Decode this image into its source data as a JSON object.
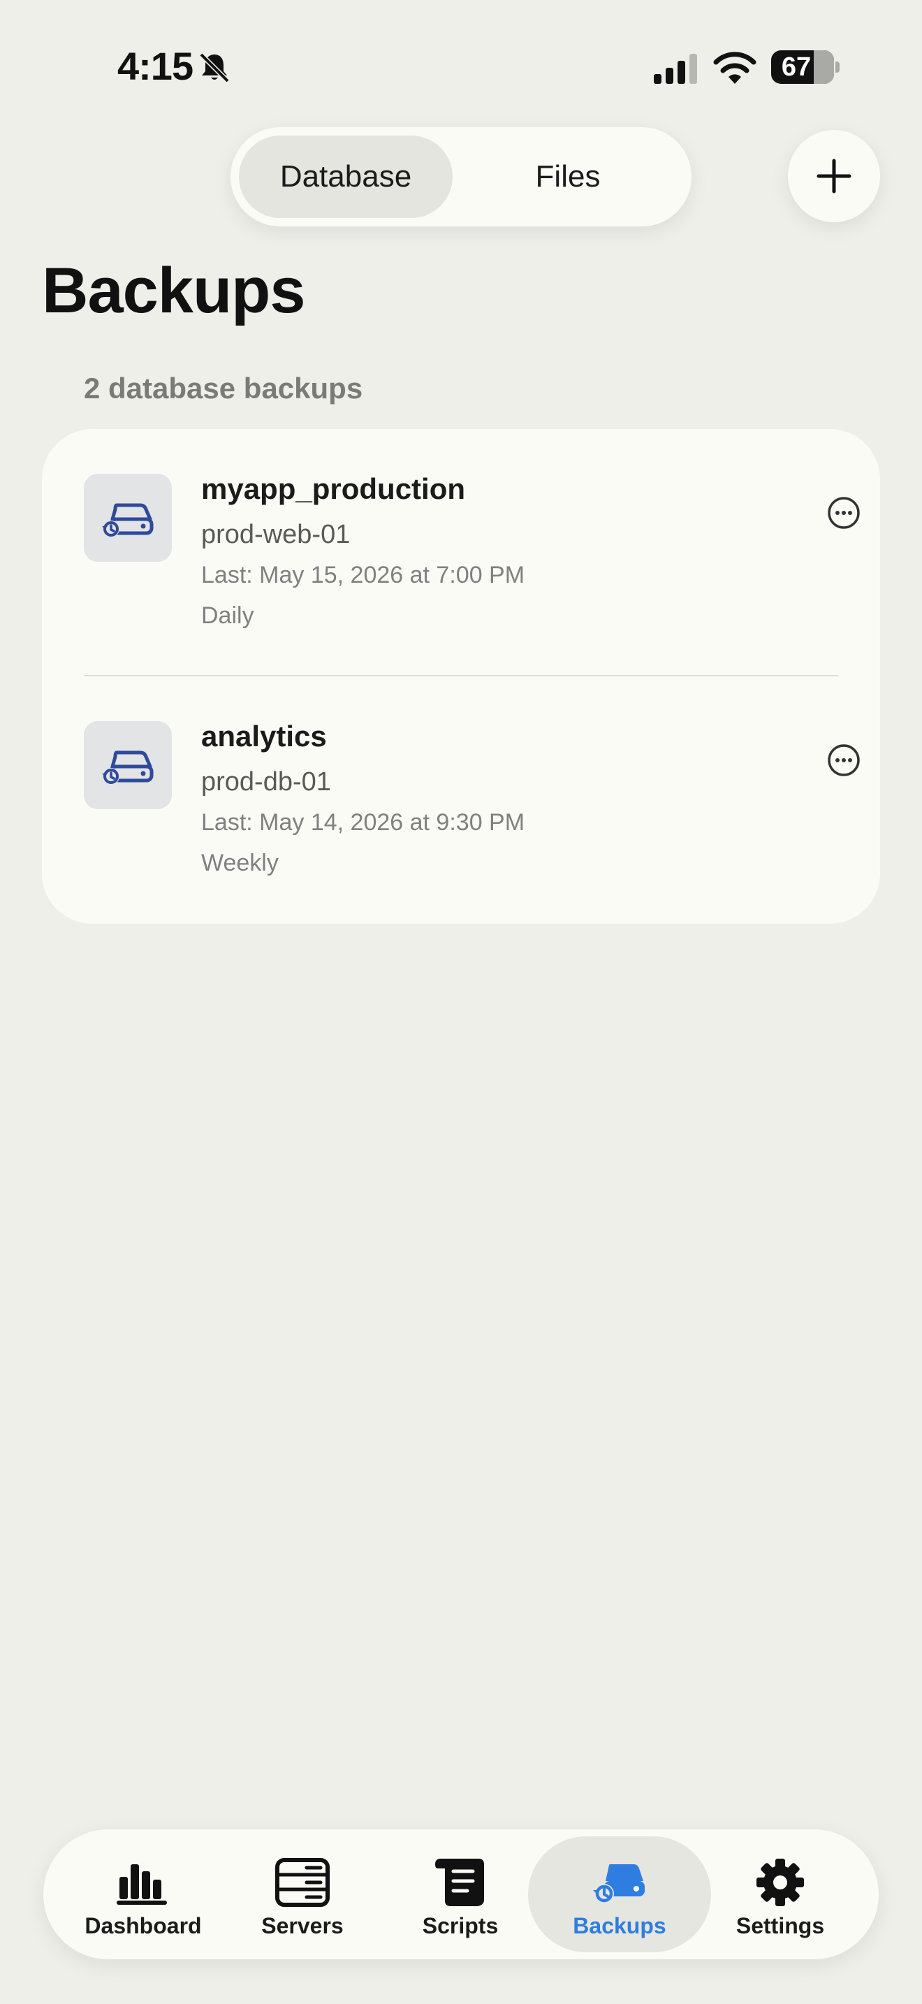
{
  "status_bar": {
    "time": "4:15",
    "battery": "67"
  },
  "segmented": {
    "database": "Database",
    "files": "Files",
    "selected": "Database"
  },
  "page": {
    "title": "Backups",
    "caption": "2 database backups"
  },
  "backups": [
    {
      "name": "myapp_production",
      "server": "prod-web-01",
      "last": "Last: May 15, 2026 at 7:00 PM",
      "frequency": "Daily"
    },
    {
      "name": "analytics",
      "server": "prod-db-01",
      "last": "Last: May 14, 2026 at 9:30 PM",
      "frequency": "Weekly"
    }
  ],
  "tabs": [
    {
      "label": "Dashboard",
      "icon": "chart-bars-icon"
    },
    {
      "label": "Servers",
      "icon": "server-rack-icon"
    },
    {
      "label": "Scripts",
      "icon": "script-scroll-icon"
    },
    {
      "label": "Backups",
      "icon": "backup-drive-icon"
    },
    {
      "label": "Settings",
      "icon": "gear-icon"
    }
  ],
  "colors": {
    "accent": "#2f7de1",
    "icon_blue": "#2f4a9a",
    "background": "#efefea",
    "card": "#fbfbf6"
  }
}
